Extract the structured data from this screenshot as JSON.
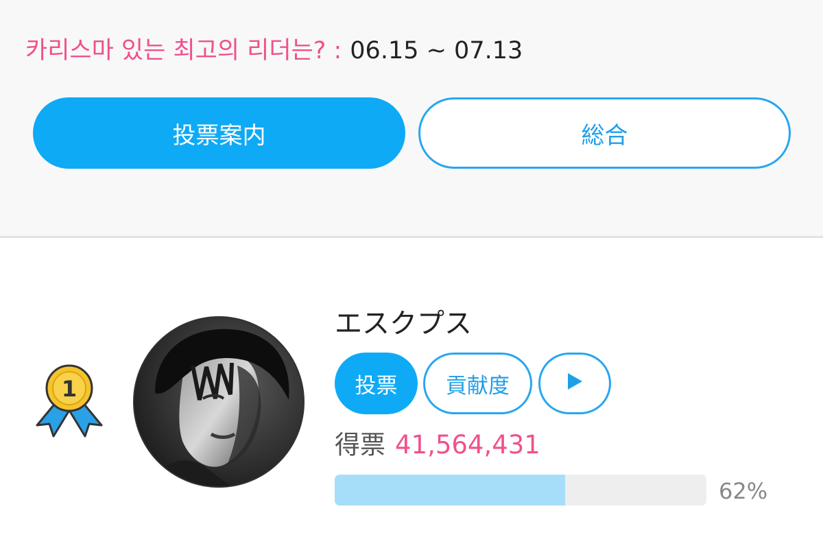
{
  "event": {
    "title": "카리스마 있는 최고의 리더는? :",
    "dates": "06.15 ~ 07.13"
  },
  "tabs": {
    "guide_label": "投票案内",
    "overall_label": "総合"
  },
  "entry": {
    "rank": "1",
    "name": "エスクプス",
    "vote_label": "投票",
    "contribution_label": "貢献度",
    "play_icon": "play-icon",
    "votes_label": "得票",
    "votes_value": "41,564,431",
    "progress_percent": 62,
    "progress_text": "62%"
  },
  "colors": {
    "accent_blue": "#0eaaf6",
    "highlight_pink": "#f0508c",
    "progress_fill": "#a6def9",
    "medal_gold": "#f5c32c",
    "ribbon_blue": "#2aa0e6"
  }
}
